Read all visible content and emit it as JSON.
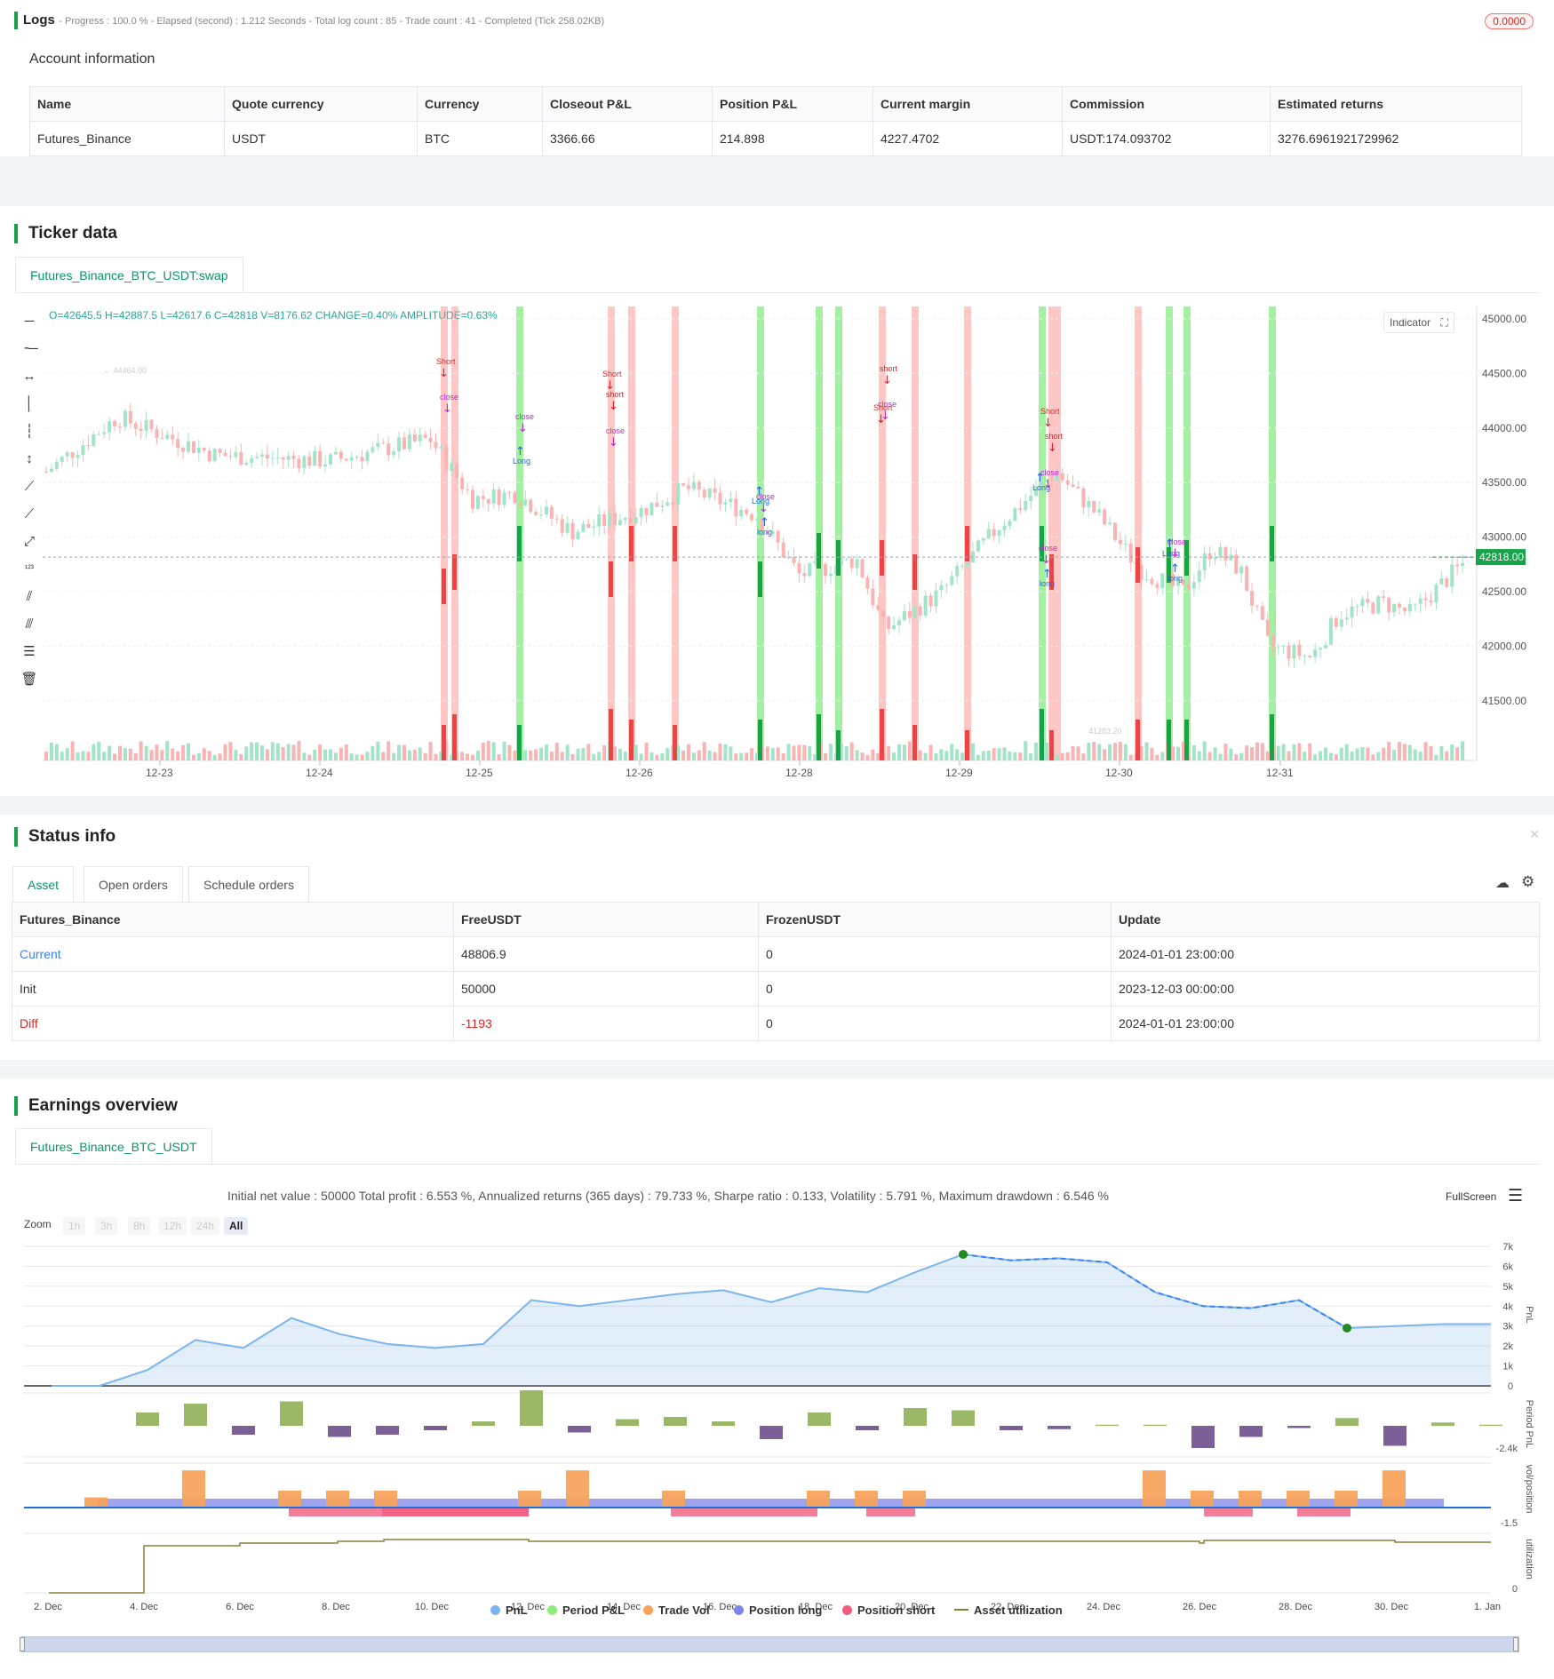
{
  "logs": {
    "title": "Logs",
    "progress_text": "- Progress : 100.0 % - Elapsed (second) : 1.212  Seconds - Total log count : 85 - Trade count : 41 - Completed (Tick 258.02KB)",
    "badge": "0.0000"
  },
  "account": {
    "title": "Account information",
    "headers": [
      "Name",
      "Quote currency",
      "Currency",
      "Closeout P&L",
      "Position P&L",
      "Current margin",
      "Commission",
      "Estimated returns"
    ],
    "row": [
      "Futures_Binance",
      "USDT",
      "BTC",
      "3366.66",
      "214.898",
      "4227.4702",
      "USDT:174.093702",
      "3276.6961921729962"
    ]
  },
  "ticker": {
    "title": "Ticker data",
    "tab": "Futures_Binance_BTC_USDT:swap",
    "ohlc": "O=42645.5 H=42887.5 L=42617.6 C=42818 V=8176.62 CHANGE=0.40% AMPLITUDE=0.63%",
    "indicator_btn": "Indicator",
    "price_ticks": [
      "45000.00",
      "44500.00",
      "44000.00",
      "43500.00",
      "43000.00",
      "42500.00",
      "42000.00",
      "41500.00"
    ],
    "current_price": "42818.00",
    "high_marker": "44464.00",
    "low_marker": "41283.20",
    "date_ticks": [
      "12-23",
      "12-24",
      "12-25",
      "12-26",
      "12-28",
      "12-29",
      "12-30",
      "12-31"
    ]
  },
  "status": {
    "title": "Status info",
    "tabs": [
      "Asset",
      "Open orders",
      "Schedule orders"
    ],
    "headers": [
      "Futures_Binance",
      "FreeUSDT",
      "FrozenUSDT",
      "Update"
    ],
    "rows": [
      [
        "Current",
        "48806.9",
        "0",
        "2024-01-01 23:00:00"
      ],
      [
        "Init",
        "50000",
        "0",
        "2023-12-03 00:00:00"
      ],
      [
        "Diff",
        "-1193",
        "0",
        "2024-01-01 23:00:00"
      ]
    ]
  },
  "earnings": {
    "title": "Earnings overview",
    "tab": "Futures_Binance_BTC_USDT",
    "summary": "Initial net value : 50000 Total profit : 6.553 %, Annualized returns (365 days) : 79.733 %, Sharpe ratio : 0.133, Volatility : 5.791 %, Maximum drawdown : 6.546 %",
    "fullscreen": "FullScreen",
    "zoom_label": "Zoom",
    "zoom_buttons": [
      "1h",
      "3h",
      "8h",
      "12h",
      "24h",
      "All"
    ],
    "pnl_ticks": [
      "7k",
      "6k",
      "5k",
      "4k",
      "3k",
      "2k",
      "1k",
      "0"
    ],
    "axis_titles": [
      "PnL",
      "Period PnL",
      "vol/position",
      "utilization"
    ],
    "period_min": "-2.4k",
    "vol_min": "-1.5",
    "util_zero": "0",
    "date_ticks": [
      "2. Dec",
      "4. Dec",
      "6. Dec",
      "8. Dec",
      "10. Dec",
      "12. Dec",
      "14. Dec",
      "16. Dec",
      "18. Dec",
      "20. Dec",
      "22. Dec",
      "24. Dec",
      "26. Dec",
      "28. Dec",
      "30. Dec",
      "1. Jan"
    ],
    "legend": [
      {
        "label": "PnL",
        "color": "#7cb5ec"
      },
      {
        "label": "Period P&L",
        "color": "#90ed7d"
      },
      {
        "label": "Trade Vol",
        "color": "#f7a35c"
      },
      {
        "label": "Position long",
        "color": "#8085e9"
      },
      {
        "label": "Position short",
        "color": "#f15c80"
      },
      {
        "label": "Asset utilization",
        "color": "#8d7b3a"
      }
    ]
  },
  "chart_data": {
    "type": "line",
    "title": "",
    "x": [
      "2. Dec",
      "3. Dec",
      "4. Dec",
      "5. Dec",
      "6. Dec",
      "7. Dec",
      "8. Dec",
      "9. Dec",
      "10. Dec",
      "11. Dec",
      "12. Dec",
      "13. Dec",
      "14. Dec",
      "15. Dec",
      "16. Dec",
      "17. Dec",
      "18. Dec",
      "19. Dec",
      "20. Dec",
      "21. Dec",
      "22. Dec",
      "23. Dec",
      "24. Dec",
      "25. Dec",
      "26. Dec",
      "27. Dec",
      "28. Dec",
      "29. Dec",
      "30. Dec",
      "31. Dec",
      "1. Jan"
    ],
    "series": [
      {
        "name": "PnL",
        "values": [
          0,
          0,
          800,
          2300,
          1900,
          3400,
          2600,
          2100,
          1900,
          2100,
          4300,
          4000,
          4300,
          4600,
          4800,
          4200,
          4900,
          4700,
          5700,
          6600,
          6300,
          6400,
          6200,
          4700,
          4000,
          3900,
          4300,
          2900,
          3000,
          3100,
          3100
        ]
      },
      {
        "name": "Period P&L",
        "values": [
          0,
          0,
          600,
          1000,
          -400,
          1100,
          -500,
          -400,
          -200,
          200,
          1600,
          -300,
          300,
          400,
          200,
          -600,
          600,
          -200,
          800,
          700,
          -200,
          -150,
          50,
          50,
          -1000,
          -500,
          -100,
          350,
          -900,
          150,
          50
        ]
      }
    ],
    "ylabel": "PnL",
    "ylim": [
      0,
      7000
    ]
  }
}
